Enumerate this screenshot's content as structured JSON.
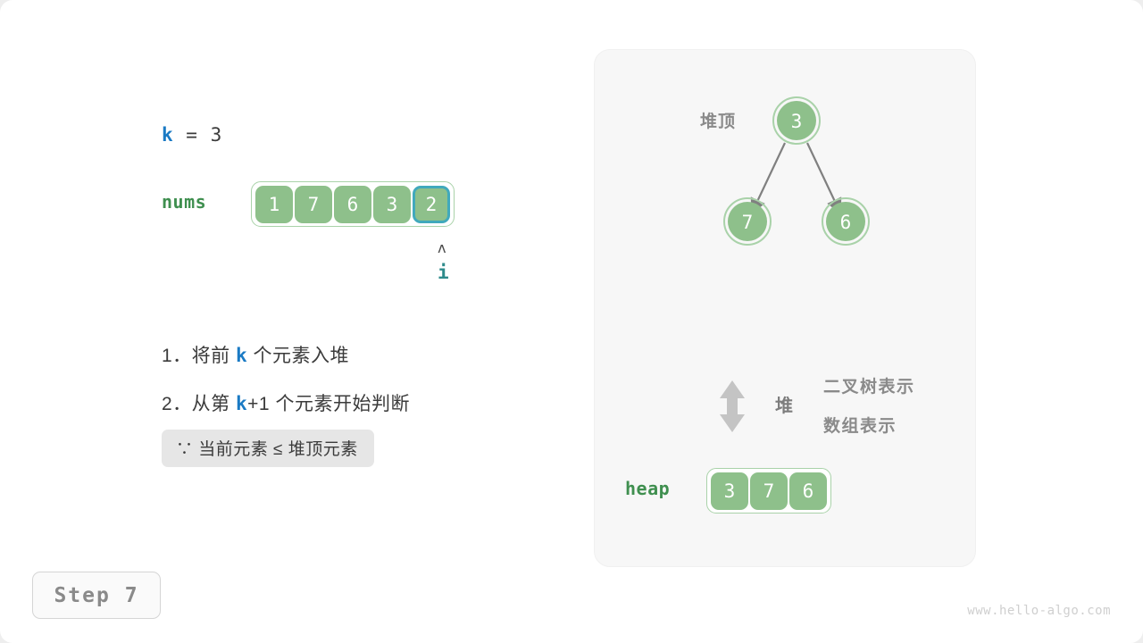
{
  "canvas": {
    "step_badge": "Step 7",
    "watermark": "www.hello-algo.com"
  },
  "left": {
    "k_var": "k",
    "k_rest": " = 3",
    "nums_label": "nums",
    "nums_values": [
      "1",
      "7",
      "6",
      "3",
      "2"
    ],
    "highlight_index": 4,
    "pointer_caret": "ʌ",
    "pointer_name": "i",
    "steps": [
      {
        "prefix": "1．将前 ",
        "var": "k",
        "suffix": " 个元素入堆"
      },
      {
        "prefix": "2．从第 ",
        "var": "k",
        "suffix": "+1 个元素开始判断"
      }
    ],
    "condition": "∵ 当前元素 ≤ 堆顶元素"
  },
  "right": {
    "heap_top_label": "堆顶",
    "tree": {
      "root": "3",
      "left_child": "7",
      "right_child": "6"
    },
    "relation_word": "堆",
    "representation_tree": "二叉树表示",
    "representation_array": "数组表示",
    "heap_label": "heap",
    "heap_values": [
      "3",
      "7",
      "6"
    ]
  },
  "colors": {
    "node_fill": "#8ec08b",
    "node_ring": "#a9d2a9",
    "highlight_border": "#41a9bc",
    "var_blue": "#1a7ac4",
    "label_green": "#3f8f4f",
    "panel_bg": "#f7f7f7",
    "arrow_gray": "#808080"
  }
}
